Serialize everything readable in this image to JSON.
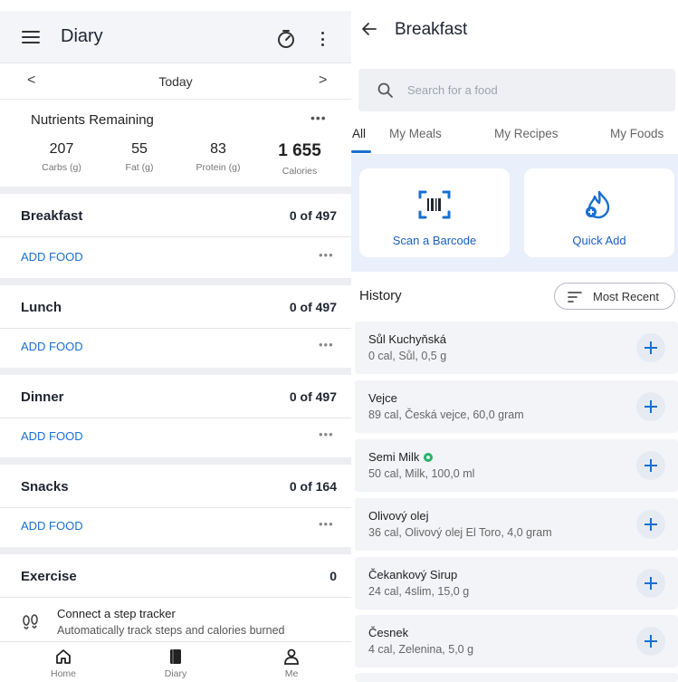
{
  "left": {
    "title": "Diary",
    "date": {
      "label": "Today",
      "prev": "<",
      "next": ">"
    },
    "nutrients": {
      "title": "Nutrients Remaining",
      "more": "•••",
      "items": [
        {
          "value": "207",
          "label": "Carbs (g)"
        },
        {
          "value": "55",
          "label": "Fat (g)"
        },
        {
          "value": "83",
          "label": "Protein (g)"
        },
        {
          "value": "1 655",
          "label": "Calories"
        }
      ]
    },
    "meals": [
      {
        "name": "Breakfast",
        "calories": "0 of 497",
        "add": "ADD FOOD",
        "more": "•••"
      },
      {
        "name": "Lunch",
        "calories": "0 of 497",
        "add": "ADD FOOD",
        "more": "•••"
      },
      {
        "name": "Dinner",
        "calories": "0 of 497",
        "add": "ADD FOOD",
        "more": "•••"
      },
      {
        "name": "Snacks",
        "calories": "0 of 164",
        "add": "ADD FOOD",
        "more": "•••"
      }
    ],
    "exercise": {
      "name": "Exercise",
      "calories": "0"
    },
    "tracker": {
      "title": "Connect a step tracker",
      "subtitle": "Automatically track steps and calories burned"
    },
    "nav": [
      {
        "label": "Home",
        "icon": "home-icon"
      },
      {
        "label": "Diary",
        "icon": "diary-icon"
      },
      {
        "label": "Me",
        "icon": "person-icon"
      }
    ]
  },
  "right": {
    "title": "Breakfast",
    "search_placeholder": "Search for a food",
    "tabs": [
      "All",
      "My Meals",
      "My Recipes",
      "My Foods"
    ],
    "tools": [
      {
        "label": "Scan a Barcode",
        "icon": "barcode-scan-icon"
      },
      {
        "label": "Quick Add",
        "icon": "flame-plus-icon"
      }
    ],
    "history": {
      "title": "History",
      "sort_label": "Most Recent",
      "items": [
        {
          "name": "Sůl Kuchyňská",
          "desc": "0 cal, Sůl, 0,5 g"
        },
        {
          "name": "Vejce",
          "desc": "89 cal, Česká vejce, 60,0 gram"
        },
        {
          "name": "Semi Milk",
          "desc": "50 cal, Milk, 100,0 ml",
          "verified": true
        },
        {
          "name": "Olivový olej",
          "desc": "36 cal, Olivový olej El Toro, 4,0 gram"
        },
        {
          "name": "Čekankový Sirup",
          "desc": "24 cal, 4slim, 15,0 g"
        },
        {
          "name": "Česnek",
          "desc": "4 cal, Zelenina, 5,0 g"
        }
      ]
    }
  },
  "colors": {
    "accent": "#1a6fd1",
    "tools_bg": "#e9f0fb",
    "verified": "#27b36a"
  }
}
